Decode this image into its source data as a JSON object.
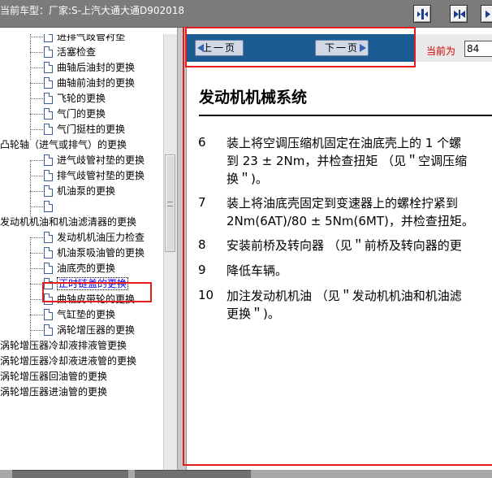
{
  "titlebar": {
    "title": "当前车型：厂家:S-上汽大通大通D902018",
    "buttons": [
      "nav-prev-icon",
      "nav-next-icon",
      "nav-last-icon"
    ]
  },
  "tree": {
    "items": [
      {
        "label": "进排气歧管衬垫",
        "level": 2
      },
      {
        "label": "活塞检查",
        "level": 2
      },
      {
        "label": "曲轴后油封的更换",
        "level": 2
      },
      {
        "label": "曲轴前油封的更换",
        "level": 2
      },
      {
        "label": "飞轮的更换",
        "level": 2
      },
      {
        "label": "气门的更换",
        "level": 2
      },
      {
        "label": "气门挺柱的更换",
        "level": 2
      },
      {
        "label": "凸轮轴（进气或排气）的更换",
        "level": 1
      },
      {
        "label": "进气歧管衬垫的更换",
        "level": 2
      },
      {
        "label": "排气歧管衬垫的更换",
        "level": 2
      },
      {
        "label": "机油泵的更换",
        "level": 2
      },
      {
        "label": "",
        "level": 2
      },
      {
        "label": "发动机机油和机油滤清器的更换",
        "level": 1
      },
      {
        "label": "发动机机油压力检查",
        "level": 2
      },
      {
        "label": "机油泵吸油管的更换",
        "level": 2
      },
      {
        "label": "油底壳的更换",
        "level": 2
      },
      {
        "label": "正时链盖的更换",
        "level": 2,
        "selected": true
      },
      {
        "label": "曲轴皮带轮的更换",
        "level": 2
      },
      {
        "label": "气缸垫的更换",
        "level": 2
      },
      {
        "label": "涡轮增压器的更换",
        "level": 2
      },
      {
        "label": "涡轮增压器冷却液排液管更换",
        "level": 1
      },
      {
        "label": "涡轮增压器冷却液进液管的更换",
        "level": 1
      },
      {
        "label": "涡轮增压器回油管的更换",
        "level": 1
      },
      {
        "label": "涡轮增压器进油管的更换",
        "level": 1
      }
    ]
  },
  "nav": {
    "prev_label": "上一页",
    "next_label": "下一页",
    "page_label": "当前为",
    "page_value": "84"
  },
  "document": {
    "title": "发动机机械系统",
    "steps": [
      {
        "num": "6",
        "lines": [
          "装上将空调压缩机固定在油底壳上的 1 个螺",
          "到 23 ± 2Nm，并检查扭矩 （见＂空调压缩",
          "换＂)。"
        ]
      },
      {
        "num": "7",
        "lines": [
          "装上将油底壳固定到变速器上的螺栓拧紧到",
          "2Nm(6AT)/80 ± 5Nm(6MT)，并检查扭矩。"
        ]
      },
      {
        "num": "8",
        "lines": [
          "安装前桥及转向器 （见＂前桥及转向器的更"
        ]
      },
      {
        "num": "9",
        "lines": [
          "降低车辆。"
        ]
      },
      {
        "num": "10",
        "lines": [
          "加注发动机机油 （见＂发动机机油和机油滤",
          "更换＂)。"
        ]
      }
    ]
  },
  "colors": {
    "titlebar": "#7b7b7b",
    "navbar": "#1b5c92",
    "highlight": "#e41e1e",
    "selected_text": "#0000ff"
  }
}
